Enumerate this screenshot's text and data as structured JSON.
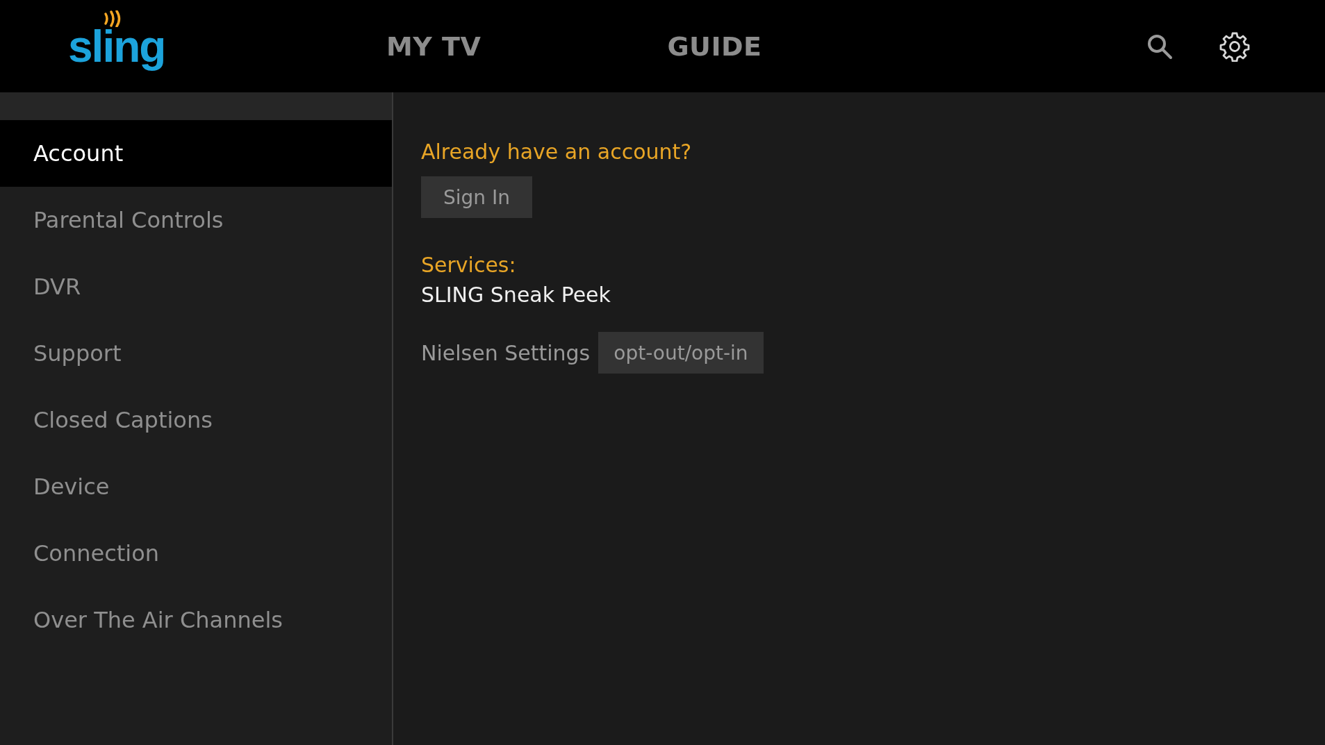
{
  "header": {
    "logo": "sling",
    "nav": [
      {
        "label": "MY TV"
      },
      {
        "label": "GUIDE"
      }
    ]
  },
  "sidebar": {
    "items": [
      {
        "label": "Account",
        "selected": true
      },
      {
        "label": "Parental Controls",
        "selected": false
      },
      {
        "label": "DVR",
        "selected": false
      },
      {
        "label": "Support",
        "selected": false
      },
      {
        "label": "Closed Captions",
        "selected": false
      },
      {
        "label": "Device",
        "selected": false
      },
      {
        "label": "Connection",
        "selected": false
      },
      {
        "label": "Over The Air Channels",
        "selected": false
      }
    ]
  },
  "account": {
    "prompt": "Already have an account?",
    "sign_in": "Sign In",
    "services_label": "Services:",
    "service": "SLING Sneak Peek",
    "nielsen_label": "Nielsen Settings",
    "nielsen_button": "opt-out/opt-in"
  }
}
